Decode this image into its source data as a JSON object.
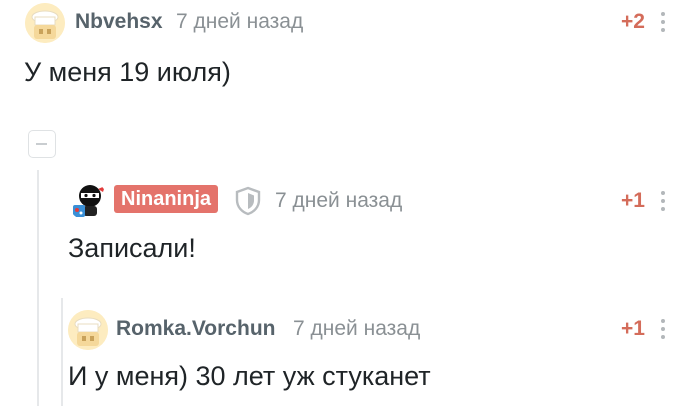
{
  "comments": [
    {
      "username": "Nbvehsx",
      "time": "7 дней назад",
      "rating": "+2",
      "text": "У меня 19 июля)"
    },
    {
      "username": "Ninaninja",
      "time": "7 дней назад",
      "rating": "+1",
      "text": "Записали!"
    },
    {
      "username": "Romka.Vorchun",
      "time": "7 дней назад",
      "rating": "+1",
      "text": "И у меня) 30 лет уж стуканет"
    }
  ],
  "colors": {
    "badge": "#e4736b",
    "rating": "#d46c5a",
    "username": "#57636b"
  }
}
